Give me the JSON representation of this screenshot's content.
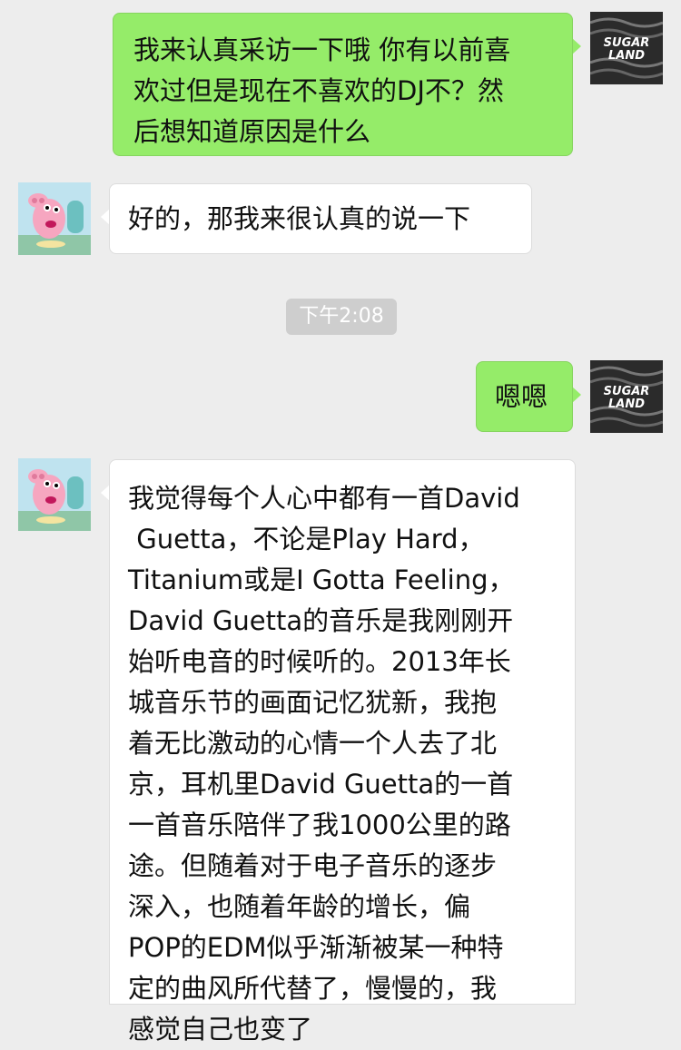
{
  "chat": {
    "messages": [
      {
        "sender": "self",
        "avatar": "sugarland-avatar",
        "avatar_text": [
          "SUGAR",
          "LAND"
        ],
        "lines": [
          "我来认真采访一下哦 你有以前喜",
          "欢过但是现在不喜欢的DJ不？然",
          "后想知道原因是什么"
        ]
      },
      {
        "sender": "other",
        "avatar": "peppa-pig-avatar",
        "lines": [
          "好的，那我来很认真的说一下"
        ]
      },
      {
        "sender": "self",
        "avatar": "sugarland-avatar",
        "avatar_text": [
          "SUGAR",
          "LAND"
        ],
        "lines": [
          "嗯嗯"
        ]
      },
      {
        "sender": "other",
        "avatar": "peppa-pig-avatar",
        "lines": [
          "我觉得每个人心中都有一首David",
          " Guetta，不论是Play Hard，",
          "Titanium或是I Gotta Feeling，",
          "David Guetta的音乐是我刚刚开",
          "始听电音的时候听的。2013年长",
          "城音乐节的画面记忆犹新，我抱",
          "着无比激动的心情一个人去了北",
          "京，耳机里David Guetta的一首",
          "一首音乐陪伴了我1000公里的路",
          "途。但随着对于电子音乐的逐步",
          "深入，也随着年龄的增长，偏",
          "POP的EDM似乎渐渐被某一种特",
          "定的曲风所代替了，慢慢的，我",
          "感觉自己也变了"
        ]
      }
    ],
    "timestamp": "下午2:08"
  }
}
